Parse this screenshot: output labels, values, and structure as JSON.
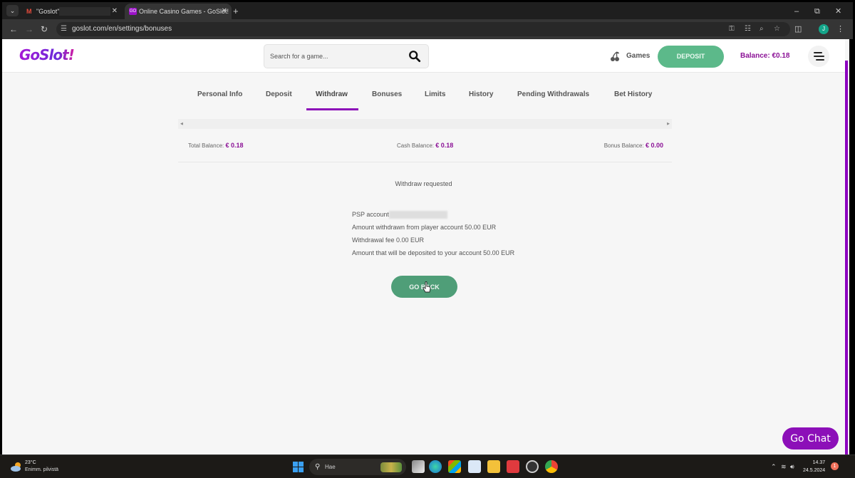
{
  "browser": {
    "tabs": [
      {
        "title": "\"Goslot\"",
        "icon": "gmail-icon",
        "active": false
      },
      {
        "title": "Online Casino Games - GoSlot!",
        "icon": "goslot-favicon",
        "active": true
      }
    ],
    "new_tab_label": "+",
    "url": "goslot.com/en/settings/bonuses",
    "profile_initial": "J",
    "window_controls": {
      "minimize": "–",
      "restore": "⧉",
      "close": "✕"
    }
  },
  "header": {
    "logo_text": "GoSlot!",
    "search_placeholder": "Search for a game...",
    "games_label": "Games",
    "deposit_label": "DEPOSIT",
    "balance_label": "Balance: €0.18"
  },
  "settings_tabs": {
    "active": "Withdraw",
    "items": [
      {
        "label": "Personal Info"
      },
      {
        "label": "Deposit"
      },
      {
        "label": "Withdraw"
      },
      {
        "label": "Bonuses"
      },
      {
        "label": "Limits"
      },
      {
        "label": "History"
      },
      {
        "label": "Pending Withdrawals"
      },
      {
        "label": "Bet History"
      }
    ],
    "scroll_left": "◀",
    "scroll_right": "▶"
  },
  "balances": {
    "total_label": "Total Balance:",
    "total_value": "€ 0.18",
    "cash_label": "Cash Balance:",
    "cash_value": "€ 0.18",
    "bonus_label": "Bonus Balance:",
    "bonus_value": "€ 0.00"
  },
  "withdraw_result": {
    "status": "Withdraw requested",
    "psp_label": "PSP account",
    "amount_withdrawn": "Amount withdrawn from player account 50.00 EUR",
    "fee": "Withdrawal fee 0.00 EUR",
    "amount_deposited": "Amount that will be deposited to your account 50.00 EUR",
    "go_back_label": "GO BACK"
  },
  "chat": {
    "label": "Go Chat"
  },
  "colors": {
    "brand_purple": "#8c0fb8",
    "deposit_green": "#5cb98a",
    "goback_green": "#4f9e78",
    "balance_text": "#8b1196"
  },
  "taskbar": {
    "weather_temp": "23°C",
    "weather_desc": "Enimm. pilvistä",
    "search_label": "Hae",
    "time": "14.37",
    "date": "24.5.2024",
    "notification_count": "1"
  }
}
